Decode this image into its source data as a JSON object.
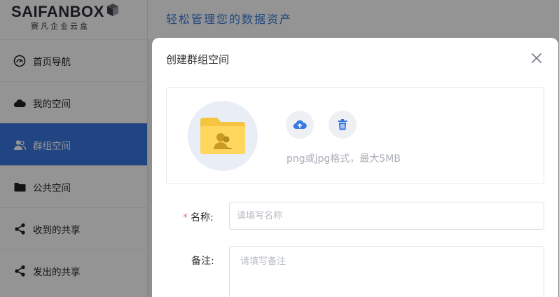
{
  "brand": {
    "logo_text": "SAIFANBOX",
    "logo_sub": "赛凡企业云盒",
    "tagline": "轻松管理您的数据资产"
  },
  "sidebar": {
    "items": [
      {
        "label": "首页导航",
        "icon": "dashboard-icon",
        "active": false
      },
      {
        "label": "我的空间",
        "icon": "cloud-icon",
        "active": false
      },
      {
        "label": "群组空间",
        "icon": "group-users-icon",
        "active": true
      },
      {
        "label": "公共空间",
        "icon": "folder-icon",
        "active": false
      },
      {
        "label": "收到的共享",
        "icon": "share-icon",
        "active": false
      },
      {
        "label": "发出的共享",
        "icon": "share-icon",
        "active": false
      }
    ]
  },
  "modal": {
    "title": "创建群组空间",
    "avatar": {
      "hint": "png或jpg格式，最大5MB",
      "icon": "group-folder-icon"
    },
    "form": {
      "name_label": "名称:",
      "name_placeholder": "请填写名称",
      "name_value": "",
      "note_label": "备注:",
      "note_placeholder": "请填写备注",
      "note_value": ""
    }
  },
  "colors": {
    "accent": "#3a78e0",
    "tagline": "#3a7bd8",
    "required": "#f56c6c",
    "folder": "#ffd75e"
  }
}
